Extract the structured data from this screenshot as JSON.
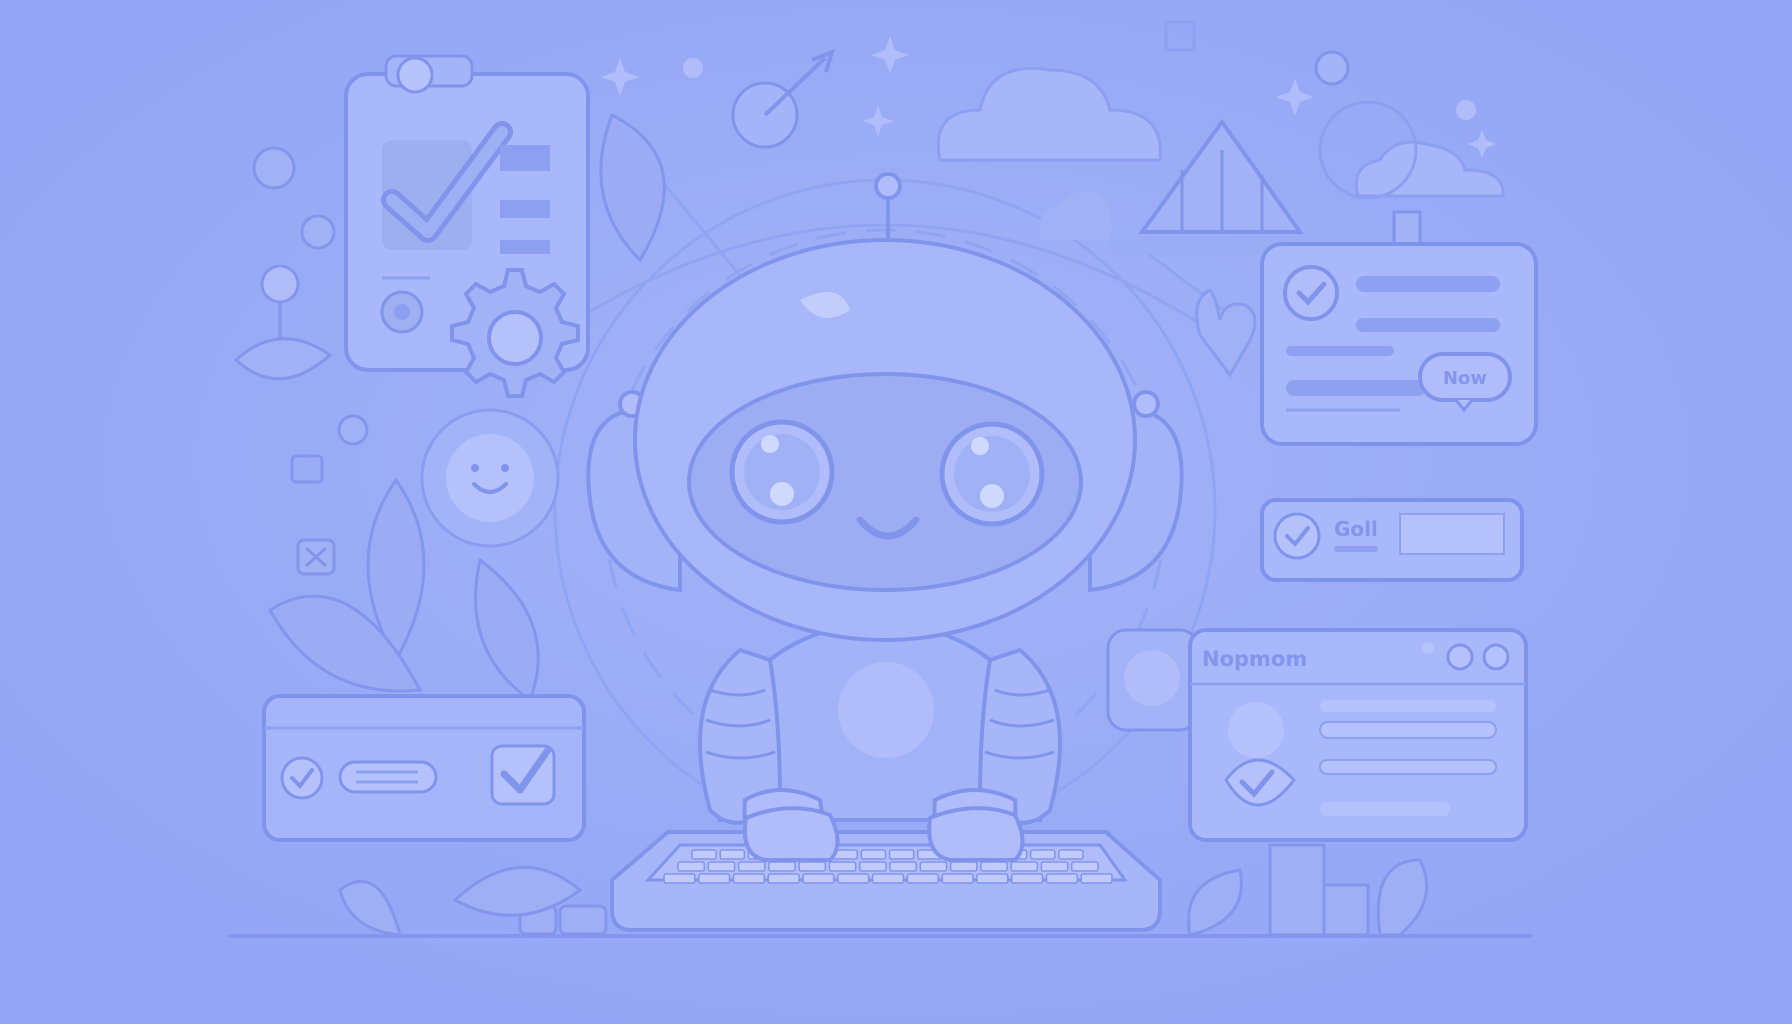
{
  "colors": {
    "background": "#96a8f6",
    "panel": "#a7b6f9",
    "panel_light": "#b4c1fb",
    "stroke": "#7f93ec",
    "shadow": "#8799ee",
    "dark_line": "#8a9cf0"
  },
  "cards": {
    "now_button_label": "Now",
    "goal_card_label": "Goll",
    "profile_window_title": "Nopmom"
  },
  "icons": [
    "robot-mascot",
    "keyboard",
    "checkmark-icon",
    "gear-icon",
    "cloud-icon",
    "heart-icon",
    "smiley-icon",
    "plant-leaf",
    "house-icon",
    "user-avatar-icon",
    "sparkle-icon"
  ]
}
